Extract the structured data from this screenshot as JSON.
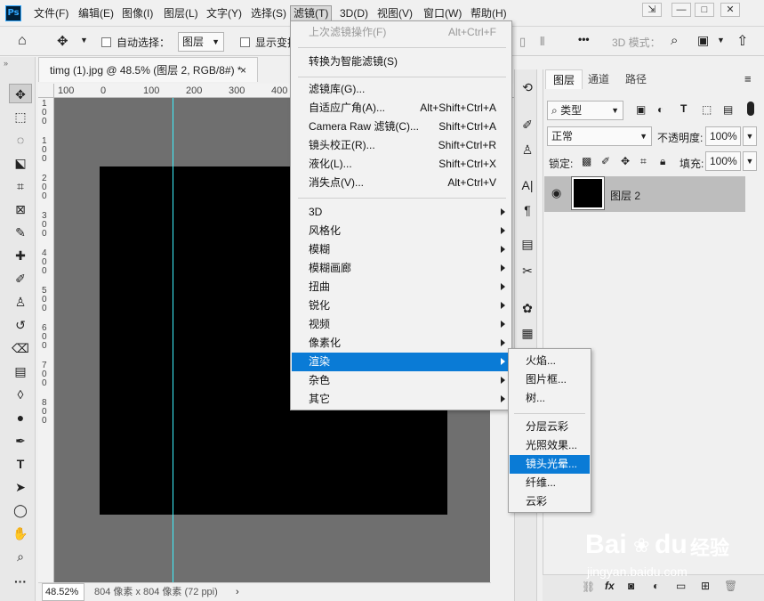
{
  "menubar": {
    "logo": "Ps",
    "items": [
      "文件(F)",
      "编辑(E)",
      "图像(I)",
      "图层(L)",
      "文字(Y)",
      "选择(S)",
      "滤镜(T)",
      "3D(D)",
      "视图(V)",
      "窗口(W)",
      "帮助(H)"
    ],
    "window_buttons": [
      "⇲",
      "—",
      "□",
      "✕"
    ]
  },
  "options": {
    "auto_select_label": "自动选择：",
    "layer_select": "图层",
    "show_transform_label": "显示变换",
    "mode_3d": "3D 模式：",
    "more": "•••"
  },
  "document": {
    "tab_title": "timg (1).jpg @ 48.5% (图层 2, RGB/8#) *",
    "close": "×",
    "ruler_top": [
      "100",
      "0",
      "100",
      "200",
      "300",
      "400"
    ],
    "ruler_left": [
      "1",
      "0",
      "0",
      "1",
      "0",
      "0",
      "2",
      "0",
      "0",
      "3",
      "0",
      "0",
      "4",
      "0",
      "0",
      "5",
      "0",
      "0",
      "6",
      "0",
      "0",
      "7",
      "0",
      "0",
      "8",
      "0",
      "0"
    ],
    "zoom": "48.52%",
    "doc_info": "804 像素 x 804 像素 (72 ppi)",
    "status_arrow": "›"
  },
  "filter_menu": {
    "last_filter": {
      "label": "上次滤镜操作(F)",
      "shortcut": "Alt+Ctrl+F"
    },
    "smart": "转换为智能滤镜(S)",
    "group1": [
      {
        "label": "滤镜库(G)...",
        "shortcut": ""
      },
      {
        "label": "自适应广角(A)...",
        "shortcut": "Alt+Shift+Ctrl+A"
      },
      {
        "label": "Camera Raw 滤镜(C)...",
        "shortcut": "Shift+Ctrl+A"
      },
      {
        "label": "镜头校正(R)...",
        "shortcut": "Shift+Ctrl+R"
      },
      {
        "label": "液化(L)...",
        "shortcut": "Shift+Ctrl+X"
      },
      {
        "label": "消失点(V)...",
        "shortcut": "Alt+Ctrl+V"
      }
    ],
    "group2": [
      "3D",
      "风格化",
      "模糊",
      "模糊画廊",
      "扭曲",
      "锐化",
      "视频",
      "像素化",
      "渲染",
      "杂色",
      "其它"
    ],
    "highlighted": "渲染"
  },
  "render_submenu": {
    "group1": [
      "火焰...",
      "图片框...",
      "树..."
    ],
    "group2": [
      "分层云彩",
      "光照效果...",
      "镜头光晕...",
      "纤维...",
      "云彩"
    ],
    "highlighted": "镜头光晕..."
  },
  "layers_panel": {
    "tabs": [
      "图层",
      "通道",
      "路径"
    ],
    "filter_type": "类型",
    "blend_mode": "正常",
    "opacity_label": "不透明度:",
    "opacity": "100%",
    "lock_label": "锁定:",
    "fill_label": "填充:",
    "fill": "100%",
    "layer_name": "图层 2"
  },
  "watermark": {
    "brand": "Bai",
    "brand2": "du",
    "product": "经验",
    "url": "jingyan.baidu.com"
  },
  "colors": {
    "accent": "#0a7bd6",
    "guide": "#3ff3ff"
  }
}
